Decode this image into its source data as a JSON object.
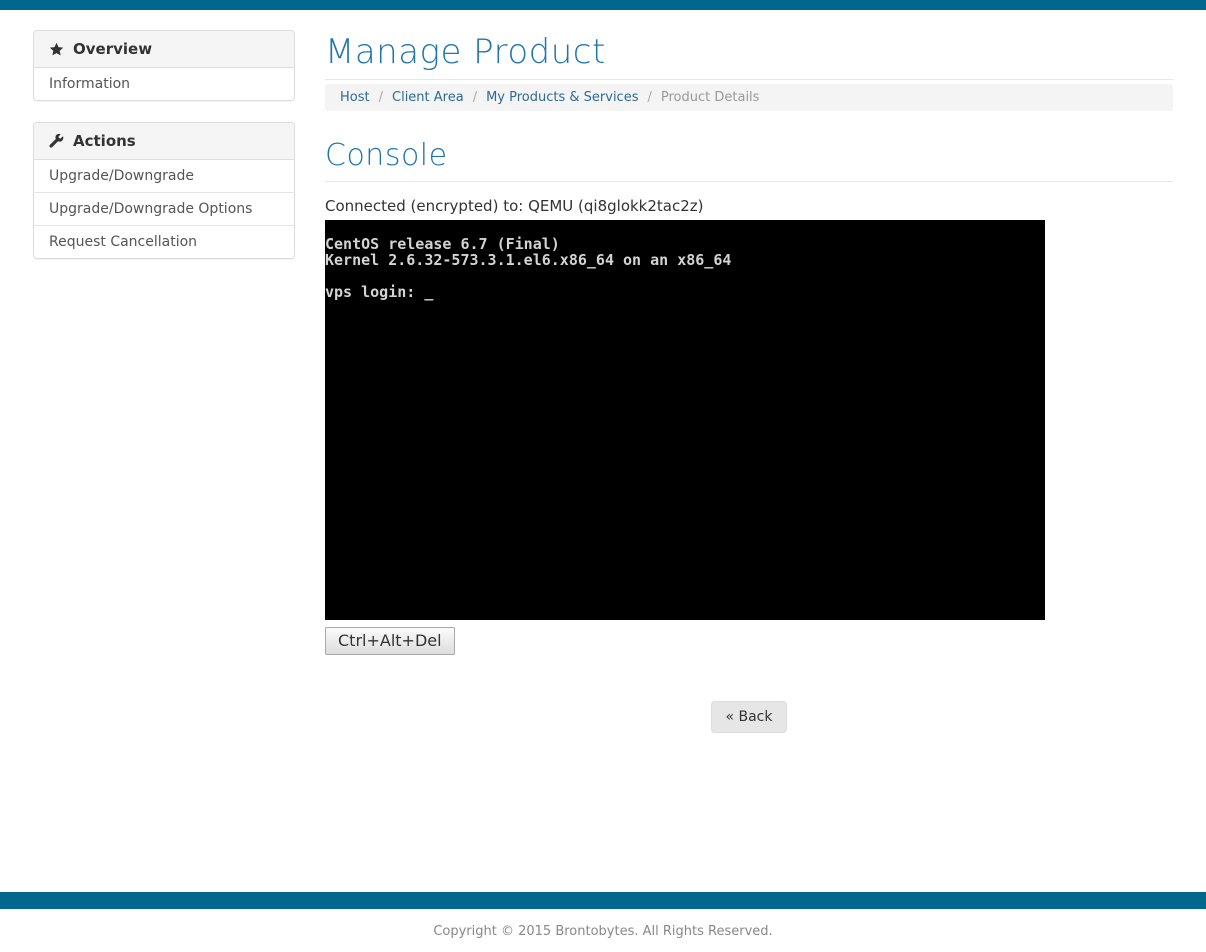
{
  "theme": {
    "accent_teal": "#00688c",
    "heading_blue": "#1f76ad",
    "link_blue": "#2d6a97",
    "console_bg": "#000000",
    "console_fg": "#d3d3d3"
  },
  "sidebar": {
    "panels": [
      {
        "title": "Overview",
        "icon": "star-icon",
        "items": [
          {
            "label": "Information"
          }
        ]
      },
      {
        "title": "Actions",
        "icon": "wrench-icon",
        "items": [
          {
            "label": "Upgrade/Downgrade"
          },
          {
            "label": "Upgrade/Downgrade Options"
          },
          {
            "label": "Request Cancellation"
          }
        ]
      }
    ]
  },
  "main": {
    "page_title": "Manage Product",
    "breadcrumb": {
      "separator": "/",
      "items": [
        {
          "label": "Host"
        },
        {
          "label": "Client Area"
        },
        {
          "label": "My Products & Services"
        },
        {
          "label": "Product Details"
        }
      ]
    },
    "section_title": "Console",
    "status_line": "Connected (encrypted) to: QEMU (qi8glokk2tac2z)",
    "console": {
      "lines": [
        "CentOS release 6.7 (Final)",
        "Kernel 2.6.32-573.3.1.el6.x86_64 on an x86_64",
        "",
        "vps login: _"
      ]
    },
    "ctrl_alt_del_label": "Ctrl+Alt+Del",
    "back_label": "« Back"
  },
  "footer": {
    "copyright": "Copyright © 2015 Brontobytes. All Rights Reserved."
  }
}
